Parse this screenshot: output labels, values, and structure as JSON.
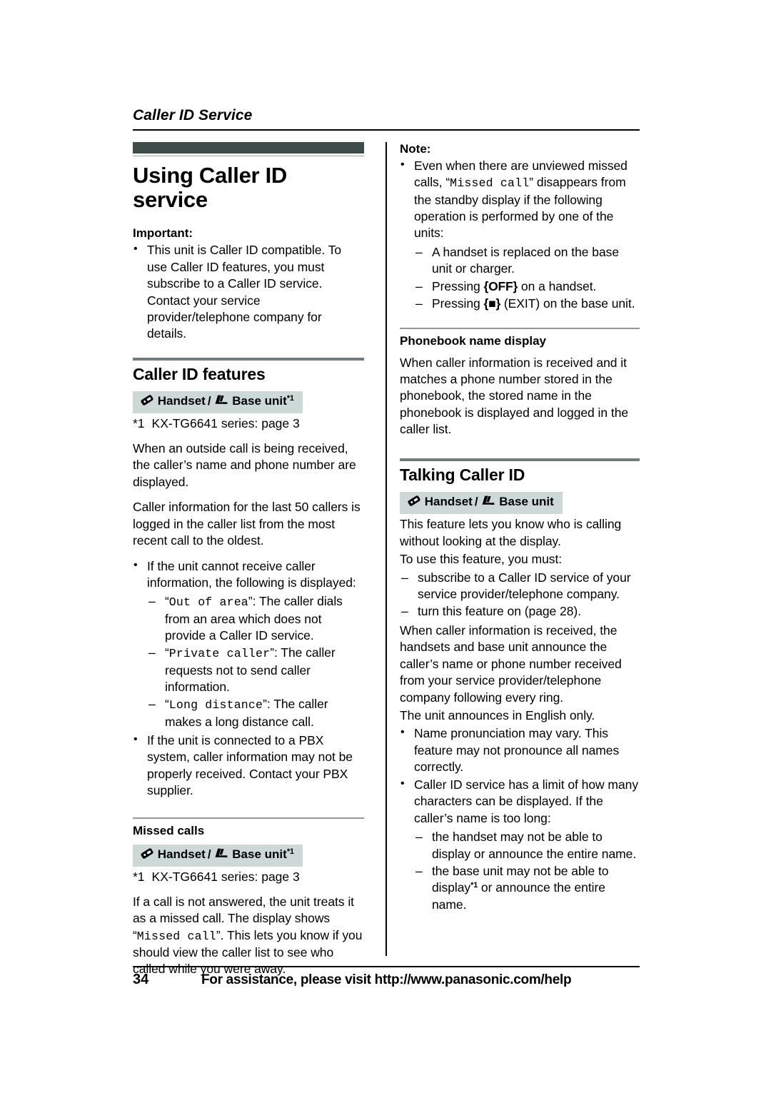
{
  "running_head": "Caller ID Service",
  "chapter": {
    "title": "Using Caller ID service",
    "important_label": "Important:",
    "important_bullets": [
      "This unit is Caller ID compatible. To use Caller ID features, you must subscribe to a Caller ID service. Contact your service provider/telephone company for details."
    ]
  },
  "caller_id_features": {
    "title": "Caller ID features",
    "badge": {
      "handset_label": "Handset",
      "separator": "/",
      "base_label": "Base unit",
      "footnote_mark": "*1",
      "handset_icon": "handset-icon",
      "base_icon": "base-unit-icon"
    },
    "footnote_mark": "*1",
    "footnote_text": "KX-TG6641 series: page 3",
    "para1": "When an outside call is being received, the caller’s name and phone number are displayed.",
    "para2": "Caller information for the last 50 callers is logged in the caller list from the most recent call to the oldest.",
    "bullet1_intro": "If the unit cannot receive caller information, the following is displayed:",
    "dash_items": [
      {
        "lcd": "Out of area",
        "rest": ": The caller dials from an area which does not provide a Caller ID service."
      },
      {
        "lcd": "Private caller",
        "rest": ": The caller requests not to send caller information."
      },
      {
        "lcd": "Long distance",
        "rest": ": The caller makes a long distance call."
      }
    ],
    "bullet2": "If the unit is connected to a PBX system, caller information may not be properly received. Contact your PBX supplier."
  },
  "missed_calls": {
    "title": "Missed calls",
    "badge": {
      "handset_label": "Handset",
      "separator": "/",
      "base_label": "Base unit",
      "footnote_mark": "*1"
    },
    "footnote_mark": "*1",
    "footnote_text": "KX-TG6641 series: page 3",
    "body_pre": "If a call is not answered, the unit treats it as a missed call. The display shows “",
    "body_lcd": "Missed call",
    "body_post": "”. This lets you know if you should view the caller list to see who called while you were away."
  },
  "note": {
    "label": "Note:",
    "bullet_pre": "Even when there are unviewed missed calls, “",
    "bullet_lcd": "Missed call",
    "bullet_post": "” disappears from the standby display if the following operation is performed by one of the units:",
    "dash_items": [
      {
        "pre": "A handset is replaced on the base unit or charger.",
        "key": "",
        "post": ""
      },
      {
        "pre": "Pressing ",
        "key": "{OFF}",
        "post": " on a handset."
      },
      {
        "pre": "Pressing ",
        "key": "{■}",
        "post": " (EXIT) on the base unit."
      }
    ]
  },
  "phonebook_name_display": {
    "title": "Phonebook name display",
    "body": "When caller information is received and it matches a phone number stored in the phonebook, the stored name in the phonebook is displayed and logged in the caller list."
  },
  "talking_caller_id": {
    "title": "Talking Caller ID",
    "badge": {
      "handset_label": "Handset",
      "separator": "/",
      "base_label": "Base unit"
    },
    "para1": "This feature lets you know who is calling without looking at the display.",
    "para2": "To use this feature, you must:",
    "dash_items": [
      "subscribe to a Caller ID service of your service provider/telephone company.",
      "turn this feature on (page 28)."
    ],
    "para3": "When caller information is received, the handsets and base unit announce the caller’s name or phone number received from your service provider/telephone company following every ring.",
    "para4": "The unit announces in English only.",
    "bullets": [
      "Name pronunciation may vary. This feature may not pronounce all names correctly.",
      "Caller ID service has a limit of how many characters can be displayed. If the caller’s name is too long:"
    ],
    "sub_dash_items": [
      {
        "pre": "the handset may not be able to display or announce the entire name.",
        "fn": "",
        "post": ""
      },
      {
        "pre": "the base unit may not be able to display",
        "fn": "*1",
        "post": " or announce the entire name."
      }
    ]
  },
  "footer": {
    "page_number": "34",
    "assistance_text": "For assistance, please visit http://www.panasonic.com/help"
  },
  "colors": {
    "chapter_bar": "#3e4b4b",
    "section_rule": "#6d7d7d",
    "badge_background": "#ccd9d6"
  }
}
